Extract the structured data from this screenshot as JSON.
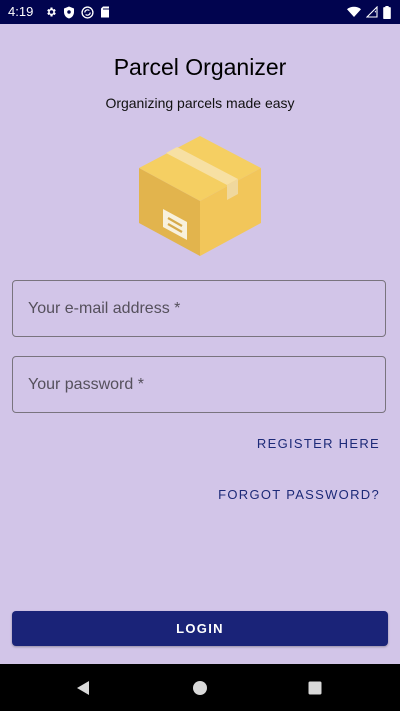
{
  "status_bar": {
    "time": "4:19",
    "icons_left": [
      "gear-icon",
      "shield-icon",
      "sync-icon",
      "sd-card-icon"
    ],
    "icons_right": [
      "wifi-icon",
      "signal-icon",
      "battery-icon"
    ]
  },
  "app": {
    "title": "Parcel Organizer",
    "subtitle": "Organizing parcels made easy",
    "logo_icon": "parcel-box-icon"
  },
  "form": {
    "email_placeholder": "Your e-mail address *",
    "email_value": "",
    "password_placeholder": "Your password *",
    "password_value": ""
  },
  "links": {
    "register": "REGISTER HERE",
    "forgot_password": "FORGOT PASSWORD?"
  },
  "actions": {
    "login": "LOGIN"
  },
  "nav_bar": {
    "icons": [
      "back-icon",
      "home-icon",
      "recents-icon"
    ]
  },
  "colors": {
    "background": "#d2c5e8",
    "status_bar": "#01044f",
    "primary": "#1a2378",
    "link": "#1d2a78"
  }
}
